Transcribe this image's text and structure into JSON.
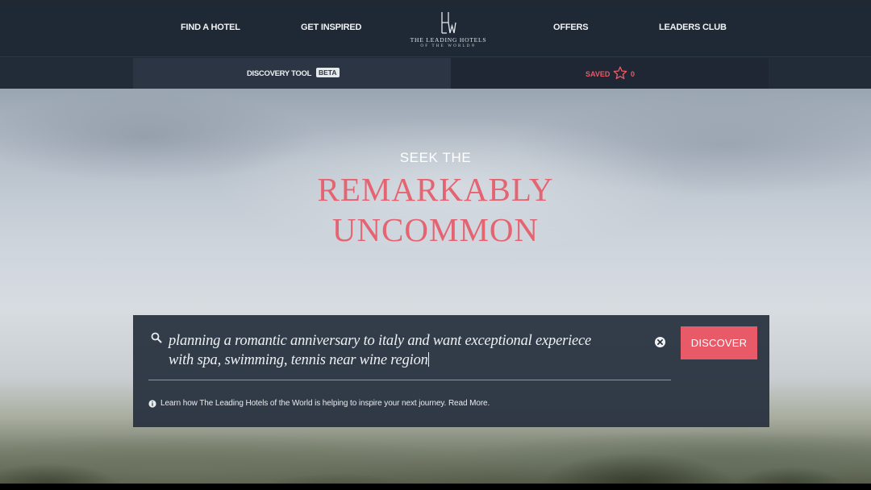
{
  "nav": {
    "find_hotel": "FIND A HOTEL",
    "get_inspired": "GET INSPIRED",
    "offers": "OFFERS",
    "leaders_club": "LEADERS CLUB",
    "logo_line1": "THE LEADING HOTELS",
    "logo_line2": "OF THE WORLD®",
    "logo_icon": "lhw-monogram-icon"
  },
  "subnav": {
    "discovery_label": "DISCOVERY TOOL",
    "beta": "BETA",
    "saved_label": "SAVED",
    "saved_icon": "star-outline-icon",
    "saved_count": "0"
  },
  "hero": {
    "seek": "SEEK THE",
    "headline_1": "REMARKABLY",
    "headline_2": "UNCOMMON"
  },
  "search": {
    "icon": "search-icon",
    "query_line1": "planning a romantic anniversary to italy and want exceptional experiece",
    "query_line2": "with spa, swimming, tennis near wine region",
    "clear_icon": "clear-circle-icon",
    "button": "DISCOVER",
    "info_icon": "info-circle-icon",
    "info_text": "Learn how The Leading Hotels of the World is helping to inspire your next journey.",
    "read_more": "Read More."
  },
  "colors": {
    "nav_bg": "#1f2936",
    "accent": "#e85a68",
    "headline": "#e56472",
    "panel_bg": "#283240"
  }
}
